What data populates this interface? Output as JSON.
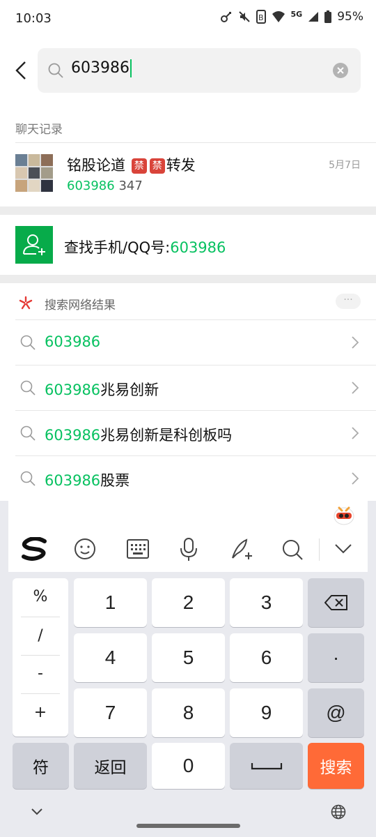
{
  "status": {
    "time": "10:03",
    "network": "5G",
    "battery": "95%"
  },
  "search": {
    "query": "603986"
  },
  "section_chat": "聊天记录",
  "chat_record": {
    "name_prefix": "铭股论道",
    "ban1": "禁",
    "ban2": "禁",
    "name_suffix": "转发",
    "sub_match": "603986",
    "sub_rest": " 347",
    "date": "5月7日"
  },
  "find": {
    "label": "查找手机/QQ号:",
    "value": "603986"
  },
  "web": {
    "title": "搜索网络结果",
    "more": "···",
    "results": [
      {
        "match": "603986",
        "rest": ""
      },
      {
        "match": "603986",
        "rest": "兆易创新"
      },
      {
        "match": "603986",
        "rest": "兆易创新是科创板吗"
      },
      {
        "match": "603986",
        "rest": "股票"
      }
    ]
  },
  "keyboard": {
    "symbols": [
      "%",
      "/",
      "-",
      "+"
    ],
    "keys": [
      "1",
      "2",
      "3",
      "4",
      "5",
      "6",
      "7",
      "8",
      "9",
      "0"
    ],
    "dot": "·",
    "at": "@",
    "fu": "符",
    "back": "返回",
    "search": "搜索"
  },
  "icons": [
    "back-icon",
    "search-icon",
    "clear-icon",
    "add-contact-icon",
    "web-search-logo-icon",
    "chevron-right-icon",
    "emoji-icon",
    "keyboard-icon",
    "mic-icon",
    "handwriting-icon",
    "keyboard-search-icon",
    "collapse-icon",
    "backspace-icon",
    "space-icon",
    "globe-icon",
    "assistant-icon"
  ]
}
